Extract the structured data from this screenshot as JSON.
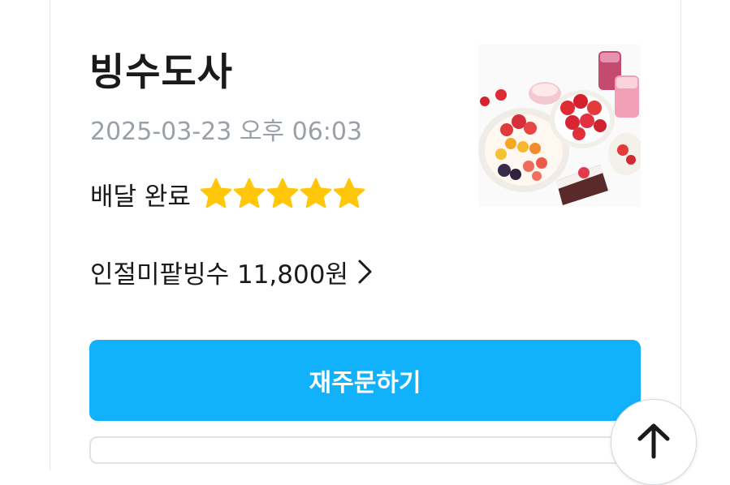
{
  "order": {
    "store_name": "빙수도사",
    "order_time": "2025-03-23 오후 06:03",
    "status": "배달 완료",
    "rating": 5,
    "rating_max": 5,
    "item_summary": "인절미팥빙수 11,800원",
    "item_chevron_icon": "chevron-right-icon",
    "thumbnail": "bingsu-dessert-photo"
  },
  "actions": {
    "reorder_label": "재주문하기"
  },
  "fab": {
    "icon": "arrow-up-icon"
  },
  "colors": {
    "primary": "#12b1fb",
    "star": "#ffc60a",
    "muted_text": "#9aa0a8",
    "text": "#1a1a1a"
  }
}
